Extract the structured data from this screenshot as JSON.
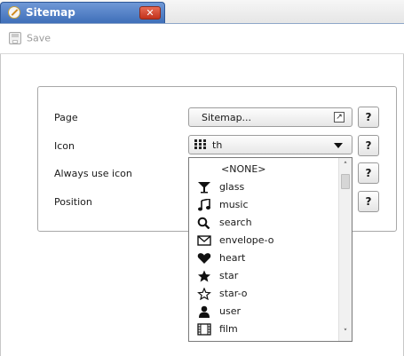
{
  "tab": {
    "title": "Sitemap",
    "close_glyph": "✕"
  },
  "toolbar": {
    "save_label": "Save",
    "save_icon": "floppy-disk-icon"
  },
  "form": {
    "page": {
      "label": "Page",
      "value": "Sitemap...",
      "help": "?"
    },
    "icon": {
      "label": "Icon",
      "value": "th",
      "help": "?"
    },
    "always_use_icon": {
      "label": "Always use icon",
      "help": "?"
    },
    "position": {
      "label": "Position",
      "help": "?"
    }
  },
  "dropdown": {
    "options": [
      {
        "label": "<NONE>",
        "icon": "none"
      },
      {
        "label": "glass",
        "icon": "glass-icon"
      },
      {
        "label": "music",
        "icon": "music-icon"
      },
      {
        "label": "search",
        "icon": "search-icon"
      },
      {
        "label": "envelope-o",
        "icon": "envelope-o-icon"
      },
      {
        "label": "heart",
        "icon": "heart-icon"
      },
      {
        "label": "star",
        "icon": "star-icon"
      },
      {
        "label": "star-o",
        "icon": "star-o-icon"
      },
      {
        "label": "user",
        "icon": "user-icon"
      },
      {
        "label": "film",
        "icon": "film-icon"
      }
    ]
  }
}
